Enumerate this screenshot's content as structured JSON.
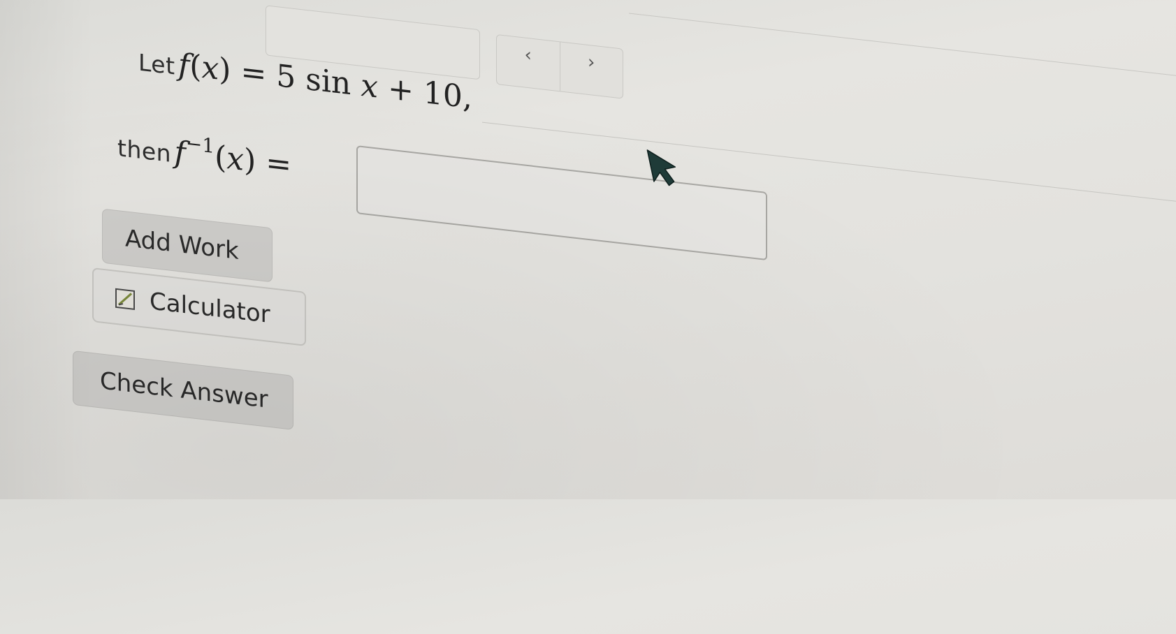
{
  "toolbar": {
    "prev_label": "‹",
    "next_label": "›"
  },
  "question": {
    "line1_lead": "Let",
    "line1_fn": "f",
    "line1_open": "(",
    "line1_var": "x",
    "line1_rest": ") = 5 sin ",
    "line1_var2": "x",
    "line1_tail": " + 10,",
    "line2_lead": "then",
    "line2_fn": "f",
    "line2_sup": "−1",
    "line2_open": "(",
    "line2_var": "x",
    "line2_tail": ") ="
  },
  "answer_input": {
    "value": ""
  },
  "buttons": {
    "add_work": "Add Work",
    "calculator": "Calculator",
    "check_answer": "Check Answer"
  },
  "colors": {
    "page_background": "#e3e2de",
    "button_background": "#cfcecb",
    "cursor": "#1f3b38",
    "calculator_icon_accent": "#7c8a3c"
  },
  "icons": {
    "calculator": "calculator-icon",
    "cursor": "mouse-pointer-icon"
  }
}
